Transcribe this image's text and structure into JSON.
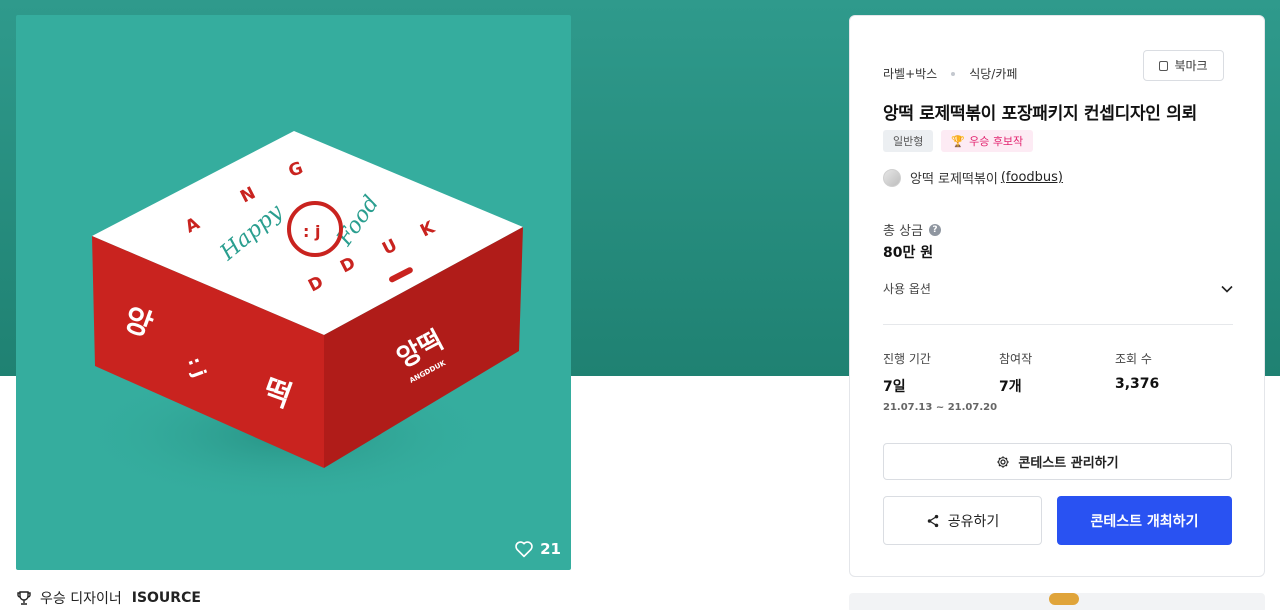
{
  "hero": {
    "bg_color": "#2f9a8c"
  },
  "image": {
    "box_text_top": [
      "A",
      "N",
      "G"
    ],
    "box_text_bottom": [
      "D",
      "D",
      "U",
      "K"
    ],
    "script_left": "Happy",
    "script_right": "Food",
    "face": ": j",
    "side_left_top": "앙",
    "side_left_bottom": "떡",
    "side_right": "앙떡",
    "side_right_sub": "ANGDDUK",
    "like_count": "21"
  },
  "winner": {
    "prefix": "우승 디자이너",
    "name": "ISOURCE"
  },
  "panel": {
    "breadcrumb": [
      "라벨+박스",
      "식당/카페"
    ],
    "bookmark_label": "북마크",
    "title": "앙떡 로제떡볶이 포장패키지 컨셉디자인 의뢰",
    "tags": {
      "type": "일반형",
      "award": "우승 후보작"
    },
    "owner": {
      "name": "앙떡 로제떡볶이",
      "handle": "(foodbus)"
    },
    "prize": {
      "label": "총 상금",
      "value": "80만 원",
      "help": "?"
    },
    "options_label": "사용 옵션",
    "stats": {
      "period": {
        "label": "진행 기간",
        "value": "7일",
        "range": "21.07.13 ~ 21.07.20"
      },
      "entries": {
        "label": "참여작",
        "value": "7개"
      },
      "views": {
        "label": "조회 수",
        "value": "3,376"
      }
    },
    "buttons": {
      "manage": "콘테스트 관리하기",
      "share": "공유하기",
      "host": "콘테스트 개최하기"
    }
  },
  "colors": {
    "primary": "#2952f2",
    "award": "#e2236f",
    "box_red": "#c9231f",
    "teal": "#35ad9e"
  }
}
